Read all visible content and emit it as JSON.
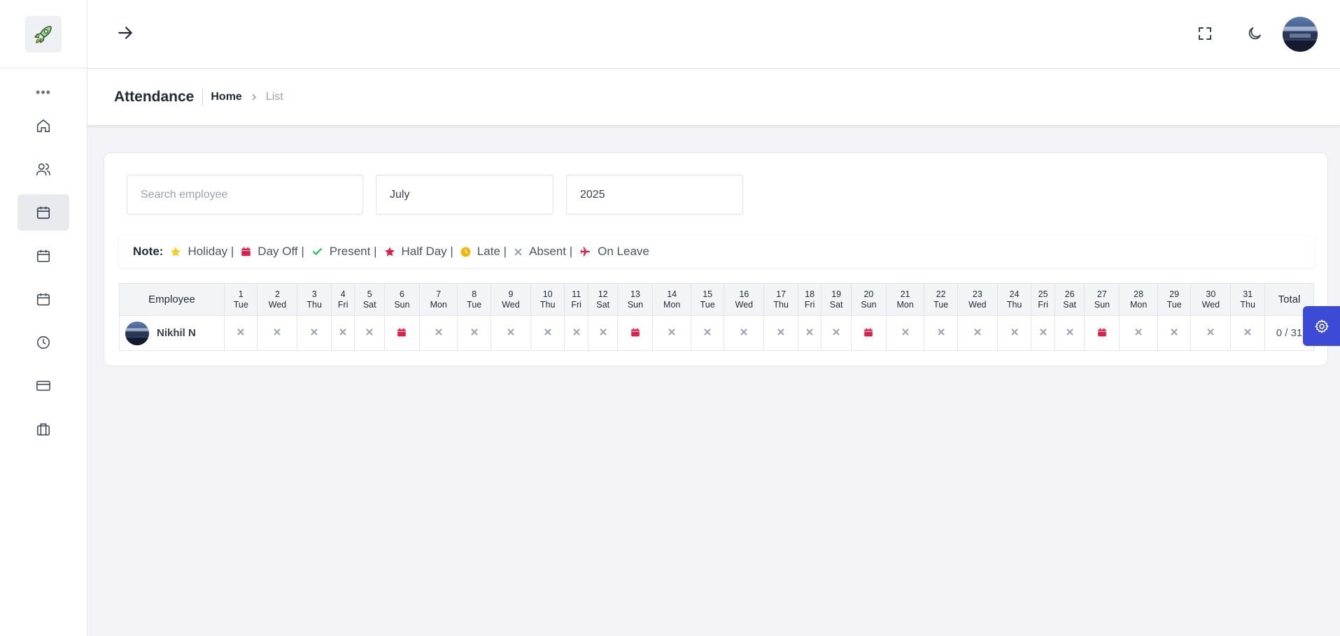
{
  "page": {
    "title": "Attendance",
    "breadcrumb": {
      "home": "Home",
      "current": "List"
    }
  },
  "sidebar": {
    "items": [
      {
        "name": "home-icon",
        "active": false
      },
      {
        "name": "users-icon",
        "active": false
      },
      {
        "name": "calendar-icon",
        "active": true
      },
      {
        "name": "calendar-icon",
        "active": false
      },
      {
        "name": "calendar-icon",
        "active": false
      },
      {
        "name": "clock-icon",
        "active": false
      },
      {
        "name": "credit-card-icon",
        "active": false
      },
      {
        "name": "briefcase-icon",
        "active": false
      }
    ]
  },
  "filters": {
    "search_placeholder": "Search employee",
    "month": "July",
    "year": "2025"
  },
  "legend": {
    "note_label": "Note:",
    "items": [
      {
        "icon": "star-icon",
        "label": "Holiday |",
        "color": "#facc15"
      },
      {
        "icon": "calendar-icon",
        "label": "Day Off |",
        "color": "#e11d48"
      },
      {
        "icon": "check-icon",
        "label": "Present |",
        "color": "#22c55e"
      },
      {
        "icon": "star-icon",
        "label": "Half Day |",
        "color": "#e11d48"
      },
      {
        "icon": "clock-icon",
        "label": "Late |",
        "color": "#f5b400"
      },
      {
        "icon": "close-icon",
        "label": "Absent |",
        "color": "#9ca3af"
      },
      {
        "icon": "plane-icon",
        "label": "On Leave",
        "color": "#e11d48"
      }
    ]
  },
  "table": {
    "employee_header": "Employee",
    "total_header": "Total",
    "days": [
      {
        "d": "1",
        "w": "Tue"
      },
      {
        "d": "2",
        "w": "Wed"
      },
      {
        "d": "3",
        "w": "Thu"
      },
      {
        "d": "4",
        "w": "Fri"
      },
      {
        "d": "5",
        "w": "Sat"
      },
      {
        "d": "6",
        "w": "Sun"
      },
      {
        "d": "7",
        "w": "Mon"
      },
      {
        "d": "8",
        "w": "Tue"
      },
      {
        "d": "9",
        "w": "Wed"
      },
      {
        "d": "10",
        "w": "Thu"
      },
      {
        "d": "11",
        "w": "Fri"
      },
      {
        "d": "12",
        "w": "Sat"
      },
      {
        "d": "13",
        "w": "Sun"
      },
      {
        "d": "14",
        "w": "Mon"
      },
      {
        "d": "15",
        "w": "Tue"
      },
      {
        "d": "16",
        "w": "Wed"
      },
      {
        "d": "17",
        "w": "Thu"
      },
      {
        "d": "18",
        "w": "Fri"
      },
      {
        "d": "19",
        "w": "Sat"
      },
      {
        "d": "20",
        "w": "Sun"
      },
      {
        "d": "21",
        "w": "Mon"
      },
      {
        "d": "22",
        "w": "Tue"
      },
      {
        "d": "23",
        "w": "Wed"
      },
      {
        "d": "24",
        "w": "Thu"
      },
      {
        "d": "25",
        "w": "Fri"
      },
      {
        "d": "26",
        "w": "Sat"
      },
      {
        "d": "27",
        "w": "Sun"
      },
      {
        "d": "28",
        "w": "Mon"
      },
      {
        "d": "29",
        "w": "Tue"
      },
      {
        "d": "30",
        "w": "Wed"
      },
      {
        "d": "31",
        "w": "Thu"
      }
    ],
    "rows": [
      {
        "name": "Nikhil N",
        "total": "0 / 31",
        "statuses": [
          "absent",
          "absent",
          "absent",
          "absent",
          "absent",
          "dayoff",
          "absent",
          "absent",
          "absent",
          "absent",
          "absent",
          "absent",
          "dayoff",
          "absent",
          "absent",
          "absent",
          "absent",
          "absent",
          "absent",
          "dayoff",
          "absent",
          "absent",
          "absent",
          "absent",
          "absent",
          "absent",
          "dayoff",
          "absent",
          "absent",
          "absent",
          "absent"
        ]
      }
    ]
  },
  "colors": {
    "accent": "#3b4bd6",
    "absent": "#9ca3af",
    "dayoff": "#e11d48"
  }
}
